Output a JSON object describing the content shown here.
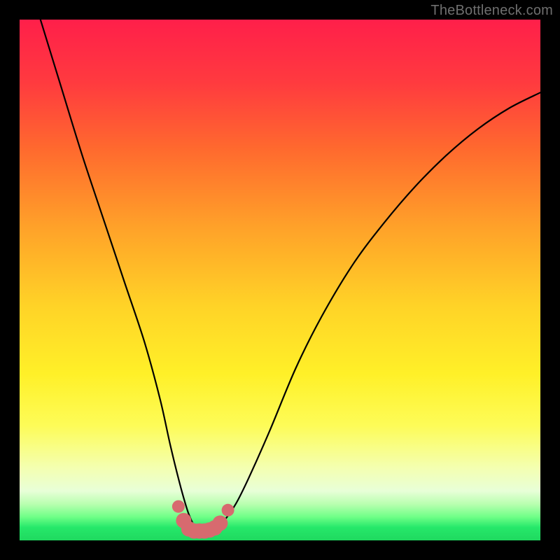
{
  "watermark": {
    "text": "TheBottleneck.com"
  },
  "colors": {
    "black": "#000000",
    "curve_stroke": "#000000",
    "marker_fill": "#d76a6f",
    "green_band": "#26e86a",
    "gradient_stops": [
      {
        "offset": 0.0,
        "color": "#ff1f4a"
      },
      {
        "offset": 0.12,
        "color": "#ff3a3f"
      },
      {
        "offset": 0.25,
        "color": "#ff6a2e"
      },
      {
        "offset": 0.4,
        "color": "#ffa229"
      },
      {
        "offset": 0.55,
        "color": "#ffd327"
      },
      {
        "offset": 0.68,
        "color": "#fff028"
      },
      {
        "offset": 0.78,
        "color": "#fdfc58"
      },
      {
        "offset": 0.86,
        "color": "#f4ffb0"
      },
      {
        "offset": 0.905,
        "color": "#e8ffd8"
      },
      {
        "offset": 0.93,
        "color": "#b9ffb0"
      },
      {
        "offset": 0.955,
        "color": "#6fff87"
      },
      {
        "offset": 0.975,
        "color": "#26e86a"
      },
      {
        "offset": 1.0,
        "color": "#1fd95f"
      }
    ]
  },
  "chart_data": {
    "type": "line",
    "title": "",
    "xlabel": "",
    "ylabel": "",
    "xlim": [
      0,
      100
    ],
    "ylim": [
      0,
      100
    ],
    "grid": false,
    "legend": false,
    "series": [
      {
        "name": "bottleneck-curve",
        "x": [
          4,
          8,
          12,
          16,
          20,
          24,
          27,
          29,
          31,
          32.5,
          34,
          35.5,
          37,
          39,
          41.5,
          44,
          48,
          53,
          58,
          64,
          70,
          76,
          82,
          88,
          94,
          100
        ],
        "y": [
          100,
          87,
          74,
          62,
          50,
          38,
          27,
          18,
          10,
          5,
          2.2,
          1.8,
          2,
          3.5,
          7,
          12,
          21,
          33,
          43,
          53,
          61,
          68,
          74,
          79,
          83,
          86
        ]
      }
    ],
    "markers": {
      "name": "highlighted-range",
      "x": [
        30.5,
        31.5,
        32.5,
        33.5,
        34.5,
        35.5,
        36.5,
        37.5,
        38.5,
        40.0
      ],
      "y": [
        6.5,
        3.8,
        2.2,
        1.8,
        1.8,
        1.8,
        2.0,
        2.4,
        3.3,
        5.8
      ],
      "size_first_last": 9,
      "size_mid": 11
    },
    "note": "x is a nominal 0–100 axis (left→right); y is bottleneck % (0 at bottom green band, 100 at top red). Values estimated from gridless plot."
  }
}
